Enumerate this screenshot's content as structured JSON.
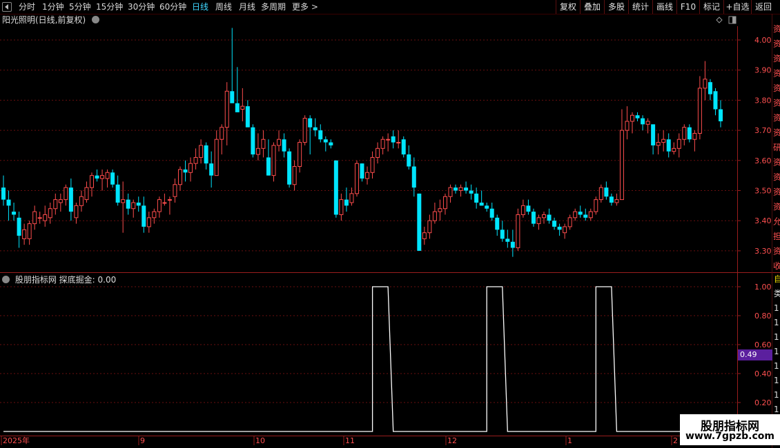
{
  "toolbar": {
    "periods": [
      "分时",
      "1分钟",
      "5分钟",
      "15分钟",
      "30分钟",
      "60分钟",
      "日线",
      "周线",
      "月线",
      "多周期",
      "更多 >"
    ],
    "active": "日线",
    "right_buttons": [
      "复权",
      "叠加",
      "多股",
      "统计",
      "画线",
      "F10",
      "标记",
      "+自选",
      "返回"
    ]
  },
  "stock": {
    "title": "阳光照明(日线,前复权)",
    "price_ticks": [
      "4.00",
      "3.90",
      "3.80",
      "3.70",
      "3.60",
      "3.50",
      "3.40",
      "3.30"
    ]
  },
  "indicator": {
    "title": "股朋指标网 探底掘金: 0.00",
    "ticks": [
      "1.00",
      "0.80",
      "0.60",
      "0.40",
      "0.20"
    ],
    "current_value": "0.49"
  },
  "date_axis": {
    "labels": [
      "2025年",
      "9",
      "10",
      "11",
      "12",
      "1",
      "2"
    ]
  },
  "right_edge_glyphs": [
    "资",
    "资",
    "资",
    "资",
    "资",
    "资",
    "资",
    "资",
    "研",
    "资",
    "资",
    "资",
    "资",
    "允",
    "担",
    "资",
    "收"
  ],
  "right_edge_glyphs_lower": [
    "自",
    "类",
    "1",
    "1",
    "1",
    "1",
    "1",
    "1",
    "1",
    "1",
    "1"
  ],
  "watermark": {
    "line1": "股朋指标网",
    "line2": "www.7gpzb.com"
  },
  "colors": {
    "up": "#ff4d4d",
    "down": "#00e5ff",
    "indicator": "#ffffff",
    "grid": "#6b0f0f",
    "active_tab": "#3fd6ff",
    "value_badge": "#5b1f9e"
  },
  "chart_data": {
    "type": "candlestick",
    "series": [
      {
        "values": [
          [
            3.51,
            3.55,
            3.45,
            3.47
          ],
          [
            3.47,
            3.5,
            3.4,
            3.45
          ],
          [
            3.43,
            3.46,
            3.4,
            3.42
          ],
          [
            3.41,
            3.43,
            3.31,
            3.35
          ],
          [
            3.34,
            3.39,
            3.32,
            3.37
          ],
          [
            3.34,
            3.4,
            3.32,
            3.39
          ],
          [
            3.39,
            3.45,
            3.37,
            3.43
          ],
          [
            3.41,
            3.43,
            3.39,
            3.41
          ],
          [
            3.4,
            3.45,
            3.38,
            3.42
          ],
          [
            3.41,
            3.46,
            3.39,
            3.44
          ],
          [
            3.44,
            3.49,
            3.42,
            3.47
          ],
          [
            3.46,
            3.49,
            3.43,
            3.47
          ],
          [
            3.47,
            3.52,
            3.45,
            3.51
          ],
          [
            3.51,
            3.54,
            3.4,
            3.43
          ],
          [
            3.41,
            3.46,
            3.39,
            3.45
          ],
          [
            3.45,
            3.5,
            3.43,
            3.48
          ],
          [
            3.47,
            3.53,
            3.46,
            3.51
          ],
          [
            3.51,
            3.56,
            3.48,
            3.55
          ],
          [
            3.55,
            3.57,
            3.53,
            3.54
          ],
          [
            3.54,
            3.57,
            3.5,
            3.55
          ],
          [
            3.54,
            3.57,
            3.51,
            3.56
          ],
          [
            3.56,
            3.57,
            3.51,
            3.52
          ],
          [
            3.52,
            3.55,
            3.45,
            3.46
          ],
          [
            3.46,
            3.53,
            3.36,
            3.47
          ],
          [
            3.47,
            3.49,
            3.42,
            3.44
          ],
          [
            3.44,
            3.47,
            3.41,
            3.46
          ],
          [
            3.46,
            3.48,
            3.43,
            3.45
          ],
          [
            3.45,
            3.48,
            3.36,
            3.38
          ],
          [
            3.38,
            3.43,
            3.36,
            3.41
          ],
          [
            3.41,
            3.44,
            3.39,
            3.43
          ],
          [
            3.43,
            3.48,
            3.41,
            3.47
          ],
          [
            3.46,
            3.49,
            3.45,
            3.46
          ],
          [
            3.47,
            3.48,
            3.42,
            3.47
          ],
          [
            3.48,
            3.54,
            3.46,
            3.52
          ],
          [
            3.52,
            3.58,
            3.5,
            3.57
          ],
          [
            3.57,
            3.6,
            3.53,
            3.56
          ],
          [
            3.56,
            3.61,
            3.53,
            3.59
          ],
          [
            3.59,
            3.64,
            3.57,
            3.61
          ],
          [
            3.61,
            3.67,
            3.59,
            3.65
          ],
          [
            3.65,
            3.66,
            3.57,
            3.59
          ],
          [
            3.59,
            3.63,
            3.51,
            3.55
          ],
          [
            3.55,
            3.7,
            3.55,
            3.67
          ],
          [
            3.67,
            3.72,
            3.62,
            3.71
          ],
          [
            3.71,
            3.86,
            3.65,
            3.83
          ],
          [
            3.83,
            4.04,
            3.81,
            3.79
          ],
          [
            3.79,
            3.91,
            3.76,
            3.76
          ],
          [
            3.77,
            3.84,
            3.73,
            3.78
          ],
          [
            3.78,
            3.8,
            3.72,
            3.71
          ],
          [
            3.71,
            3.72,
            3.61,
            3.62
          ],
          [
            3.62,
            3.69,
            3.6,
            3.64
          ],
          [
            3.64,
            3.7,
            3.61,
            3.67
          ],
          [
            3.61,
            3.67,
            3.55,
            3.55
          ],
          [
            3.55,
            3.66,
            3.53,
            3.65
          ],
          [
            3.65,
            3.7,
            3.63,
            3.67
          ],
          [
            3.67,
            3.69,
            3.61,
            3.63
          ],
          [
            3.63,
            3.64,
            3.51,
            3.52
          ],
          [
            3.52,
            3.6,
            3.5,
            3.58
          ],
          [
            3.58,
            3.67,
            3.56,
            3.66
          ],
          [
            3.66,
            3.75,
            3.65,
            3.74
          ],
          [
            3.74,
            3.75,
            3.62,
            3.71
          ],
          [
            3.71,
            3.74,
            3.68,
            3.7
          ],
          [
            3.7,
            3.72,
            3.66,
            3.67
          ],
          [
            3.67,
            3.68,
            3.63,
            3.66
          ],
          [
            3.66,
            3.67,
            3.64,
            3.65
          ],
          [
            3.6,
            3.6,
            3.41,
            3.42
          ],
          [
            3.42,
            3.49,
            3.4,
            3.47
          ],
          [
            3.47,
            3.51,
            3.43,
            3.45
          ],
          [
            3.46,
            3.51,
            3.45,
            3.49
          ],
          [
            3.49,
            3.6,
            3.48,
            3.59
          ],
          [
            3.59,
            3.59,
            3.53,
            3.54
          ],
          [
            3.54,
            3.58,
            3.52,
            3.56
          ],
          [
            3.56,
            3.63,
            3.54,
            3.61
          ],
          [
            3.61,
            3.66,
            3.59,
            3.64
          ],
          [
            3.64,
            3.68,
            3.62,
            3.67
          ],
          [
            3.67,
            3.69,
            3.63,
            3.67
          ],
          [
            3.68,
            3.7,
            3.64,
            3.66
          ],
          [
            3.66,
            3.7,
            3.64,
            3.66
          ],
          [
            3.67,
            3.68,
            3.61,
            3.62
          ],
          [
            3.62,
            3.65,
            3.57,
            3.58
          ],
          [
            3.58,
            3.61,
            3.48,
            3.51
          ],
          [
            3.49,
            3.49,
            3.3,
            3.3
          ],
          [
            3.34,
            3.38,
            3.32,
            3.36
          ],
          [
            3.36,
            3.42,
            3.34,
            3.4
          ],
          [
            3.4,
            3.46,
            3.39,
            3.43
          ],
          [
            3.43,
            3.47,
            3.4,
            3.44
          ],
          [
            3.44,
            3.49,
            3.42,
            3.48
          ],
          [
            3.48,
            3.52,
            3.46,
            3.51
          ],
          [
            3.51,
            3.52,
            3.49,
            3.5
          ],
          [
            3.5,
            3.52,
            3.48,
            3.51
          ],
          [
            3.51,
            3.53,
            3.49,
            3.5
          ],
          [
            3.5,
            3.52,
            3.47,
            3.49
          ],
          [
            3.49,
            3.51,
            3.44,
            3.46
          ],
          [
            3.46,
            3.5,
            3.45,
            3.45
          ],
          [
            3.45,
            3.46,
            3.43,
            3.44
          ],
          [
            3.44,
            3.46,
            3.4,
            3.41
          ],
          [
            3.41,
            3.42,
            3.35,
            3.37
          ],
          [
            3.37,
            3.4,
            3.33,
            3.34
          ],
          [
            3.34,
            3.37,
            3.31,
            3.33
          ],
          [
            3.33,
            3.37,
            3.28,
            3.31
          ],
          [
            3.31,
            3.44,
            3.3,
            3.42
          ],
          [
            3.42,
            3.47,
            3.41,
            3.45
          ],
          [
            3.45,
            3.47,
            3.42,
            3.43
          ],
          [
            3.43,
            3.44,
            3.38,
            3.39
          ],
          [
            3.39,
            3.42,
            3.37,
            3.41
          ],
          [
            3.41,
            3.43,
            3.39,
            3.42
          ],
          [
            3.42,
            3.44,
            3.39,
            3.4
          ],
          [
            3.4,
            3.41,
            3.37,
            3.38
          ],
          [
            3.38,
            3.39,
            3.35,
            3.37
          ],
          [
            3.36,
            3.39,
            3.34,
            3.38
          ],
          [
            3.38,
            3.42,
            3.37,
            3.41
          ],
          [
            3.41,
            3.44,
            3.4,
            3.43
          ],
          [
            3.43,
            3.45,
            3.41,
            3.42
          ],
          [
            3.42,
            3.44,
            3.4,
            3.41
          ],
          [
            3.41,
            3.44,
            3.4,
            3.43
          ],
          [
            3.43,
            3.48,
            3.42,
            3.47
          ],
          [
            3.47,
            3.52,
            3.46,
            3.51
          ],
          [
            3.51,
            3.53,
            3.47,
            3.48
          ],
          [
            3.48,
            3.49,
            3.45,
            3.46
          ],
          [
            3.46,
            3.49,
            3.45,
            3.47
          ],
          [
            3.47,
            3.77,
            3.47,
            3.7
          ],
          [
            3.7,
            3.78,
            3.67,
            3.73
          ],
          [
            3.73,
            3.76,
            3.69,
            3.75
          ],
          [
            3.75,
            3.76,
            3.73,
            3.74
          ],
          [
            3.74,
            3.75,
            3.7,
            3.72
          ],
          [
            3.72,
            3.74,
            3.69,
            3.73
          ],
          [
            3.72,
            3.72,
            3.62,
            3.65
          ],
          [
            3.65,
            3.69,
            3.62,
            3.66
          ],
          [
            3.66,
            3.7,
            3.63,
            3.67
          ],
          [
            3.67,
            3.69,
            3.61,
            3.63
          ],
          [
            3.63,
            3.66,
            3.62,
            3.64
          ],
          [
            3.64,
            3.69,
            3.61,
            3.67
          ],
          [
            3.67,
            3.72,
            3.65,
            3.71
          ],
          [
            3.71,
            3.72,
            3.66,
            3.67
          ],
          [
            3.67,
            3.7,
            3.63,
            3.69
          ],
          [
            3.69,
            3.88,
            3.67,
            3.84
          ],
          [
            3.84,
            3.93,
            3.8,
            3.87
          ],
          [
            3.86,
            3.87,
            3.8,
            3.82
          ],
          [
            3.83,
            3.84,
            3.75,
            3.77
          ],
          [
            3.77,
            3.8,
            3.71,
            3.73
          ]
        ]
      }
    ]
  },
  "indicator_data": {
    "type": "line",
    "segments": [
      {
        "start": 0,
        "end": 71,
        "value": 0
      },
      {
        "start": 71,
        "end": 74,
        "value": 1
      },
      {
        "start": 75,
        "end": 93,
        "value": 0
      },
      {
        "start": 93,
        "end": 96,
        "value": 1
      },
      {
        "start": 97,
        "end": 114,
        "value": 0
      },
      {
        "start": 114,
        "end": 117,
        "value": 1
      },
      {
        "start": 118,
        "end": 145,
        "value": 0
      }
    ],
    "ylim": [
      0,
      1
    ]
  }
}
